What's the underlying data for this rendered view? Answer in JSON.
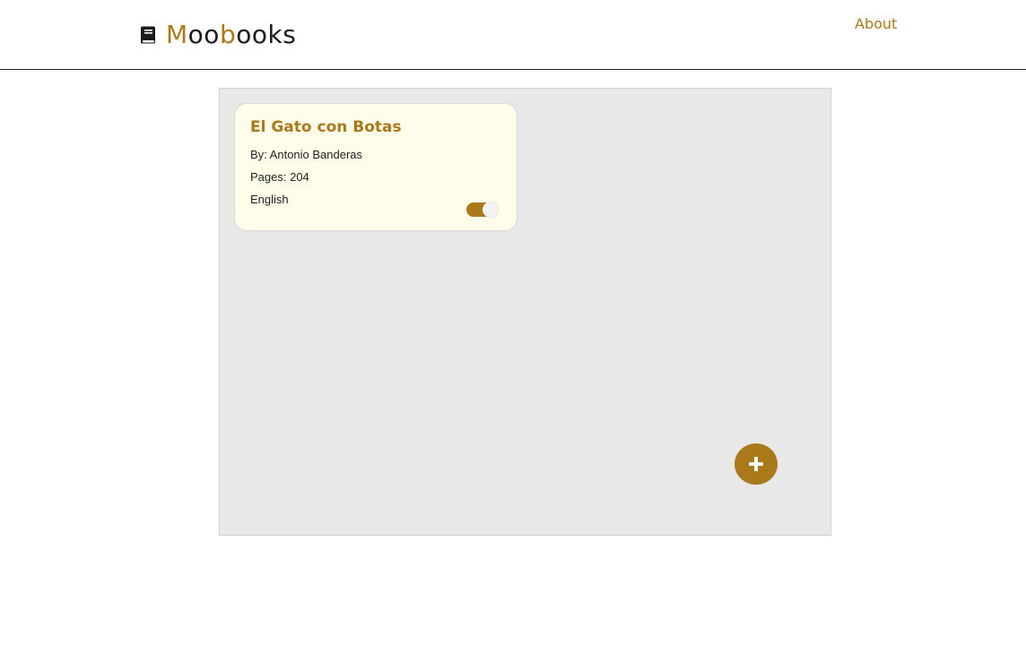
{
  "brand": {
    "name_parts": [
      "M",
      "oo",
      "b",
      "ooks"
    ],
    "icon": "book-icon"
  },
  "nav": {
    "about_label": "About"
  },
  "colors": {
    "accent": "#a9791a",
    "board_bg": "#e8e8e8",
    "card_bg": "#fffdea"
  },
  "books": [
    {
      "title": "El Gato con Botas",
      "author_line": "By: Antonio Banderas",
      "pages_line": "Pages: 204",
      "language": "English",
      "read_toggle_on": true
    }
  ],
  "add_button": {
    "icon": "plus-icon"
  }
}
